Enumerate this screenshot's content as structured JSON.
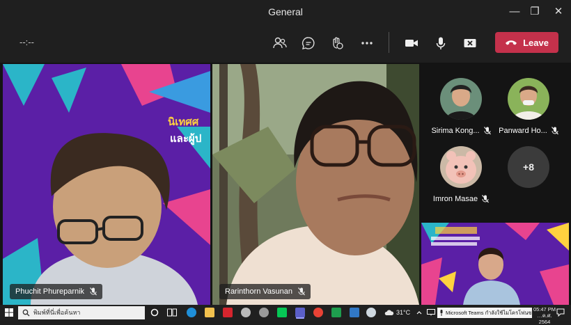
{
  "window": {
    "title": "General"
  },
  "toolbar": {
    "timer": "--:--",
    "leave_label": "Leave"
  },
  "tiles": [
    {
      "name": "Phuchit Phureparnik",
      "muted": true,
      "overlay_text_1": "นิเทศศ",
      "overlay_text_2": "และผู้ป"
    },
    {
      "name": "Rarinthorn Vasunan",
      "muted": true
    }
  ],
  "gallery": [
    {
      "name": "Sirima Kong...",
      "muted": true
    },
    {
      "name": "Panward Ho...",
      "muted": true
    },
    {
      "name": "Imron Masae",
      "muted": true
    }
  ],
  "overflow": {
    "label": "+8"
  },
  "taskbar": {
    "search_placeholder": "พิมพ์ที่นี่เพื่อค้นหา",
    "weather": "31°C",
    "notification": "Microsoft Teams กำลังใช้ไมโครโฟนของคุณ",
    "time": "05:47 PM",
    "date": "…ค.ศ. 2564"
  },
  "colors": {
    "leave": "#c4314b",
    "purple_bg": "#5b1fa6",
    "teal": "#2bb5c8",
    "pink": "#e8448f"
  }
}
